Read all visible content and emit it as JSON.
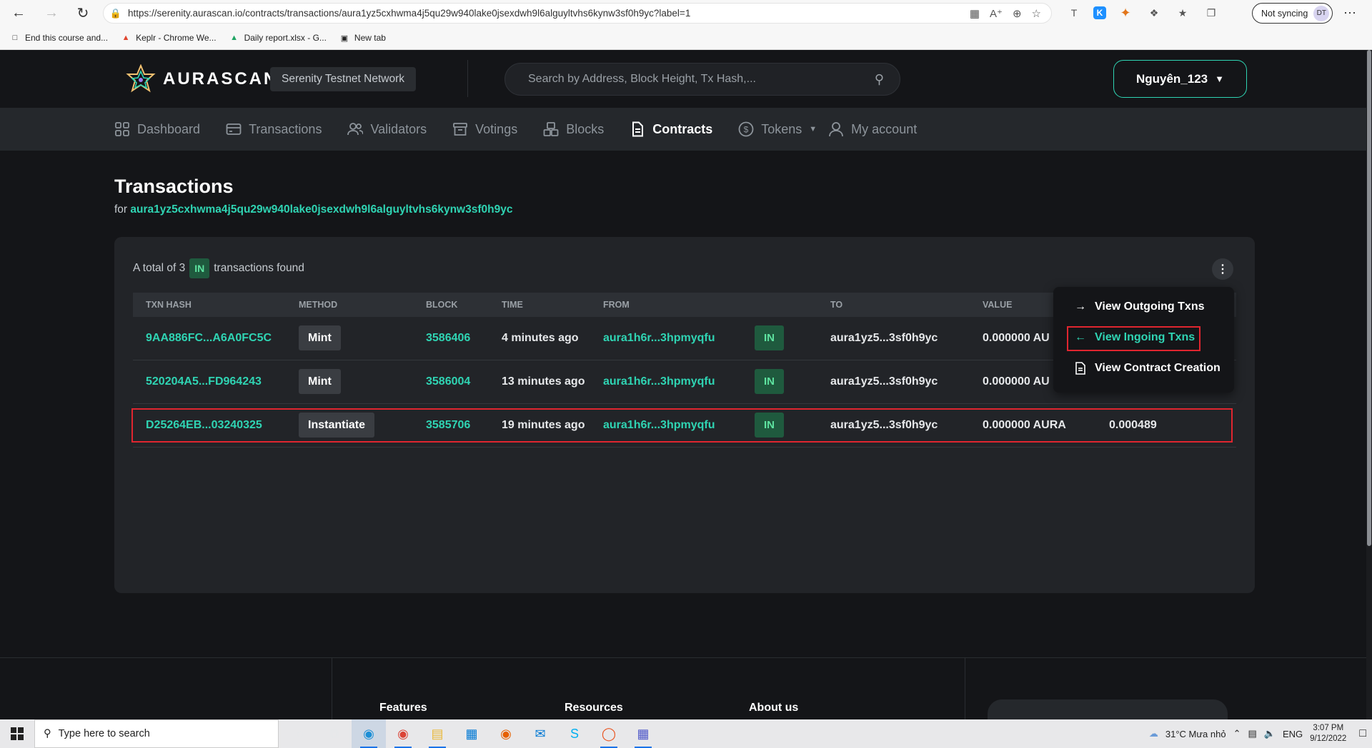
{
  "browser": {
    "url": "https://serenity.aurascan.io/contracts/transactions/aura1yz5cxhwma4j5qu29w940lake0jsexdwh9l6alguyltvhs6kynw3sf0h9yc?label=1",
    "sync_label": "Not syncing",
    "profile_initials": "DT",
    "bookmarks": [
      {
        "label": "End this course and...",
        "icon": "page-icon"
      },
      {
        "label": "Keplr - Chrome We...",
        "icon": "keplr-icon"
      },
      {
        "label": "Daily report.xlsx - G...",
        "icon": "drive-icon"
      },
      {
        "label": "New tab",
        "icon": "newtab-icon"
      }
    ]
  },
  "header": {
    "logo_text": "AURASCAN",
    "network": "Serenity Testnet Network",
    "search_placeholder": "Search by Address, Block Height, Tx Hash,...",
    "account": "Nguyên_123"
  },
  "nav": {
    "items": [
      {
        "label": "Dashboard",
        "icon": "dashboard-icon",
        "active": false
      },
      {
        "label": "Transactions",
        "icon": "card-icon",
        "active": false
      },
      {
        "label": "Validators",
        "icon": "users-icon",
        "active": false
      },
      {
        "label": "Votings",
        "icon": "archive-icon",
        "active": false
      },
      {
        "label": "Blocks",
        "icon": "blocks-icon",
        "active": false
      },
      {
        "label": "Contracts",
        "icon": "document-icon",
        "active": true
      },
      {
        "label": "Tokens",
        "icon": "coin-icon",
        "active": false
      },
      {
        "label": "My account",
        "icon": "user-icon",
        "active": false
      }
    ]
  },
  "page": {
    "title": "Transactions",
    "for_label": "for",
    "address": "aura1yz5cxhwma4j5qu29w940lake0jsexdwh9l6alguyltvhs6kynw3sf0h9yc"
  },
  "summary": {
    "prefix": "A total of 3",
    "tag": "IN",
    "suffix": "transactions found"
  },
  "table": {
    "columns": [
      "TXN HASH",
      "METHOD",
      "BLOCK",
      "TIME",
      "FROM",
      "TO",
      "VALUE"
    ],
    "rows": [
      {
        "hash": "9AA886FC...A6A0FC5C",
        "method": "Mint",
        "block": "3586406",
        "time": "4 minutes ago",
        "from": "aura1h6r...3hpmyqfu",
        "direction": "IN",
        "to": "aura1yz5...3sf0h9yc",
        "value": "0.000000 AU",
        "fee": ""
      },
      {
        "hash": "520204A5...FD964243",
        "method": "Mint",
        "block": "3586004",
        "time": "13 minutes ago",
        "from": "aura1h6r...3hpmyqfu",
        "direction": "IN",
        "to": "aura1yz5...3sf0h9yc",
        "value": "0.000000 AU",
        "fee": ""
      },
      {
        "hash": "D25264EB...03240325",
        "method": "Instantiate",
        "block": "3585706",
        "time": "19 minutes ago",
        "from": "aura1h6r...3hpmyqfu",
        "direction": "IN",
        "to": "aura1yz5...3sf0h9yc",
        "value": "0.000000 AURA",
        "fee": "0.000489"
      }
    ]
  },
  "dropdown": {
    "items": [
      {
        "label": "View Outgoing Txns",
        "icon": "arrow-right-icon",
        "active": false
      },
      {
        "label": "View Ingoing Txns",
        "icon": "arrow-left-icon",
        "active": true
      },
      {
        "label": "View Contract Creation",
        "icon": "document-icon",
        "active": false
      }
    ]
  },
  "footer": {
    "links": [
      "Features",
      "Resources",
      "About us"
    ]
  },
  "taskbar": {
    "search_placeholder": "Type here to search",
    "weather": "31°C  Mưa nhỏ",
    "lang": "ENG",
    "time": "3:07 PM",
    "date": "9/12/2022"
  },
  "colors": {
    "accent": "#2fd4b3",
    "in_tag_bg": "#1f5a3e",
    "in_tag_text": "#5ee3a0",
    "highlight_border": "#e0252f",
    "page_bg": "#141518",
    "card_bg": "#222428"
  }
}
